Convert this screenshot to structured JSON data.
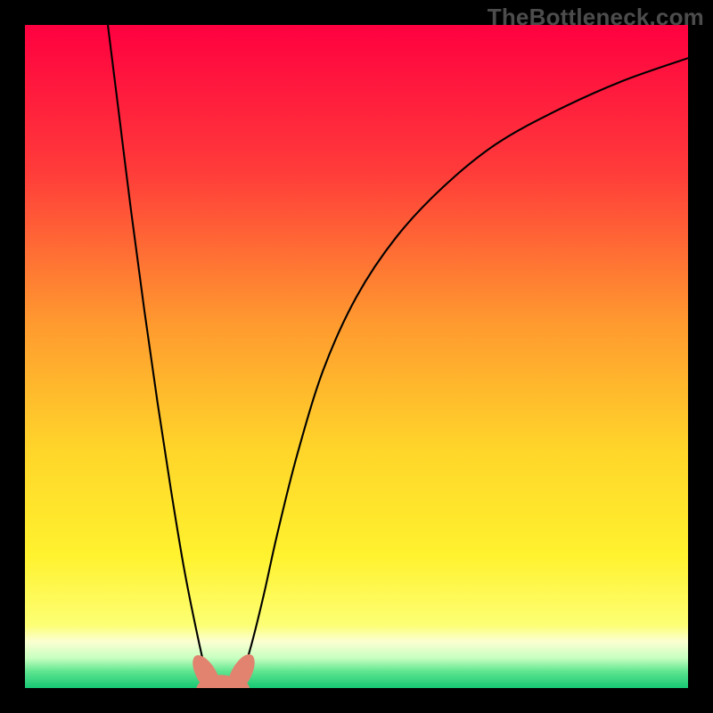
{
  "watermark": {
    "text": "TheBottleneck.com"
  },
  "chart_data": {
    "type": "line",
    "title": "",
    "xlabel": "",
    "ylabel": "",
    "xlim": [
      0,
      100
    ],
    "ylim": [
      0,
      100
    ],
    "grid": false,
    "legend": false,
    "background": {
      "type": "vertical-gradient",
      "stops": [
        {
          "pos": 0.0,
          "color": "#ff0040"
        },
        {
          "pos": 0.22,
          "color": "#ff3b3a"
        },
        {
          "pos": 0.45,
          "color": "#ff9a2f"
        },
        {
          "pos": 0.64,
          "color": "#ffd52a"
        },
        {
          "pos": 0.8,
          "color": "#fff22e"
        },
        {
          "pos": 0.905,
          "color": "#fdff74"
        },
        {
          "pos": 0.93,
          "color": "#fbffd2"
        },
        {
          "pos": 0.955,
          "color": "#c7ffc0"
        },
        {
          "pos": 0.975,
          "color": "#5fe58f"
        },
        {
          "pos": 1.0,
          "color": "#17c774"
        }
      ]
    },
    "series": [
      {
        "name": "curve",
        "color": "#000000",
        "width": 2.1,
        "x": [
          12.5,
          14,
          16,
          18,
          20,
          22,
          24,
          26,
          27.4,
          28.4,
          30.5,
          32.6,
          34,
          36,
          38,
          41,
          45,
          50,
          56,
          63,
          71,
          80,
          90,
          100
        ],
        "y": [
          100,
          88,
          72,
          57,
          43,
          30,
          18,
          8,
          2,
          0,
          0,
          2,
          6,
          14,
          23,
          35,
          48,
          59,
          68,
          75.5,
          82,
          87,
          91.5,
          95
        ]
      }
    ],
    "markers": [
      {
        "name": "m1",
        "x": 27.4,
        "y": 2.0,
        "rx": 1.5,
        "ry": 3.3,
        "angle": -30,
        "color": "#e2836f"
      },
      {
        "name": "m2",
        "x": 28.8,
        "y": 0.3,
        "rx": 1.6,
        "ry": 3.0,
        "angle": 78,
        "color": "#e2836f"
      },
      {
        "name": "m3",
        "x": 30.9,
        "y": 0.2,
        "rx": 1.6,
        "ry": 3.0,
        "angle": 98,
        "color": "#e2836f"
      },
      {
        "name": "m4",
        "x": 32.6,
        "y": 2.1,
        "rx": 1.5,
        "ry": 3.3,
        "angle": 28,
        "color": "#e2836f"
      }
    ]
  }
}
